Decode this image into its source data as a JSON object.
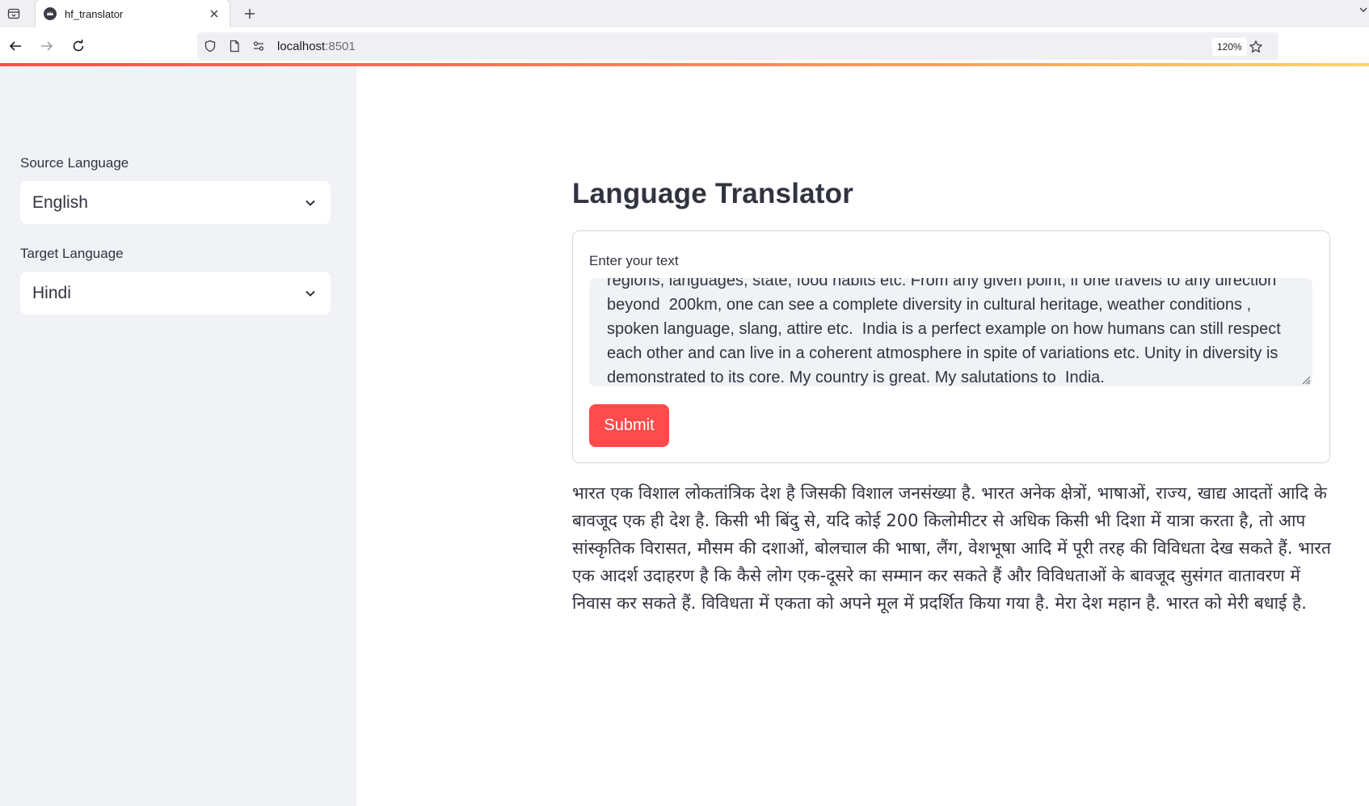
{
  "browser": {
    "tab": {
      "title": "hf_translator",
      "favicon": "streamlit-crown-icon"
    },
    "url": {
      "host": "localhost",
      "port": ":8501"
    },
    "zoom": "120%",
    "icons": {
      "tab_list": "tab-list-icon",
      "new_tab": "plus-icon",
      "back": "arrow-left-icon",
      "forward": "arrow-right-icon",
      "reload": "reload-icon",
      "shield": "shield-icon",
      "page": "page-icon",
      "permissions": "permissions-icon",
      "bookmark": "star-icon"
    }
  },
  "theme": {
    "accent": "#ff4b4b",
    "sidebar_bg": "#f0f2f6",
    "text": "#31333f"
  },
  "sidebar": {
    "source": {
      "label": "Source Language",
      "value": "English"
    },
    "target": {
      "label": "Target Language",
      "value": "Hindi"
    }
  },
  "main": {
    "title": "Language Translator",
    "form": {
      "label": "Enter your text",
      "text_value": "regions, languages, state, food habits etc. From any given point, if one travels to any direction beyond  200km, one can see a complete diversity in cultural heritage, weather conditions , spoken language, slang, attire etc.  India is a perfect example on how humans can still respect each other and can live in a coherent atmosphere in spite of variations etc. Unity in diversity is demonstrated to its core. My country is great. My salutations to  India.",
      "submit_label": "Submit"
    },
    "output": "भारत एक विशाल लोकतांत्रिक देश है जिसकी विशाल जनसंख्या है. भारत अनेक क्षेत्रों, भाषाओं, राज्य, खाद्य आदतों आदि के बावजूद एक ही देश है. किसी भी बिंदु से, यदि कोई 200 किलोमीटर से अधिक किसी भी दिशा में यात्रा करता है, तो आप सांस्कृतिक विरासत, मौसम की दशाओं, बोलचाल की भाषा, लैंग, वेशभूषा आदि में पूरी तरह की विविधता देख सकते हैं. भारत एक आदर्श उदाहरण है कि कैसे लोग एक-दूसरे का सम्मान कर सकते हैं और विविधताओं के बावजूद सुसंगत वातावरण में निवास कर सकते हैं. विविधता में एकता को अपने मूल में प्रदर्शित किया गया है. मेरा देश महान है. भारत को मेरी बधाई है."
  }
}
